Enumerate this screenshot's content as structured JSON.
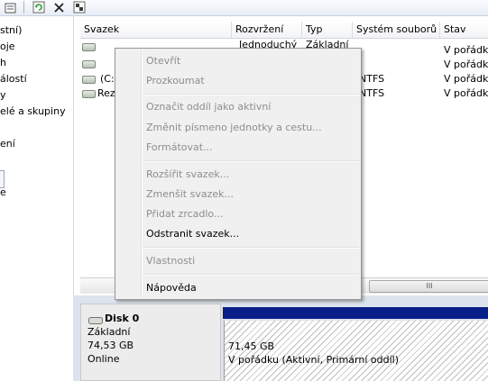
{
  "toolbar": {
    "buttons": [
      {
        "icon": "properties-icon"
      },
      {
        "icon": "refresh-icon"
      },
      {
        "icon": "delete-icon"
      },
      {
        "icon": "help-icon"
      }
    ]
  },
  "tree": {
    "items": [
      "stní)",
      "oje",
      "h",
      "álostí",
      "y",
      "elé a skupiny",
      "ení",
      "e"
    ]
  },
  "volume_list": {
    "headers": [
      "Svazek",
      "Rozvržení",
      "Typ",
      "Systém souborů",
      "Stav"
    ],
    "rows": [
      {
        "volume": "",
        "layout": "Jednoduchý",
        "type": "Základní",
        "fs": "",
        "status": "V pořádku"
      },
      {
        "volume": "",
        "layout": "",
        "type": "",
        "fs": "",
        "status": "V pořádku"
      },
      {
        "volume": "(C:",
        "layout": "",
        "type": "",
        "fs": "NTFS",
        "status": "V pořádku"
      },
      {
        "volume": "Rez",
        "layout": "",
        "type": "",
        "fs": "NTFS",
        "status": "V pořádku"
      }
    ],
    "scroll_glyph": "III"
  },
  "disk": {
    "name": "Disk 0",
    "type": "Základní",
    "size": "74,53 GB",
    "status": "Online",
    "partition": {
      "size": "71,45 GB",
      "status": "V pořádku (Aktivní, Primární oddíl)"
    }
  },
  "context_menu": {
    "items": [
      {
        "label": "Otevřít",
        "enabled": false
      },
      {
        "label": "Prozkoumat",
        "enabled": false
      },
      {
        "label": "Označit oddíl jako aktivní",
        "enabled": false
      },
      {
        "label": "Změnit písmeno jednotky a cestu...",
        "enabled": false
      },
      {
        "label": "Formátovat...",
        "enabled": false
      },
      {
        "label": "Rozšířit svazek...",
        "enabled": false
      },
      {
        "label": "Zmenšit svazek...",
        "enabled": false
      },
      {
        "label": "Přidat zrcadlo...",
        "enabled": false
      },
      {
        "label": "Odstranit svazek...",
        "enabled": true
      },
      {
        "label": "Vlastnosti",
        "enabled": false
      },
      {
        "label": "Nápověda",
        "enabled": true
      }
    ]
  }
}
